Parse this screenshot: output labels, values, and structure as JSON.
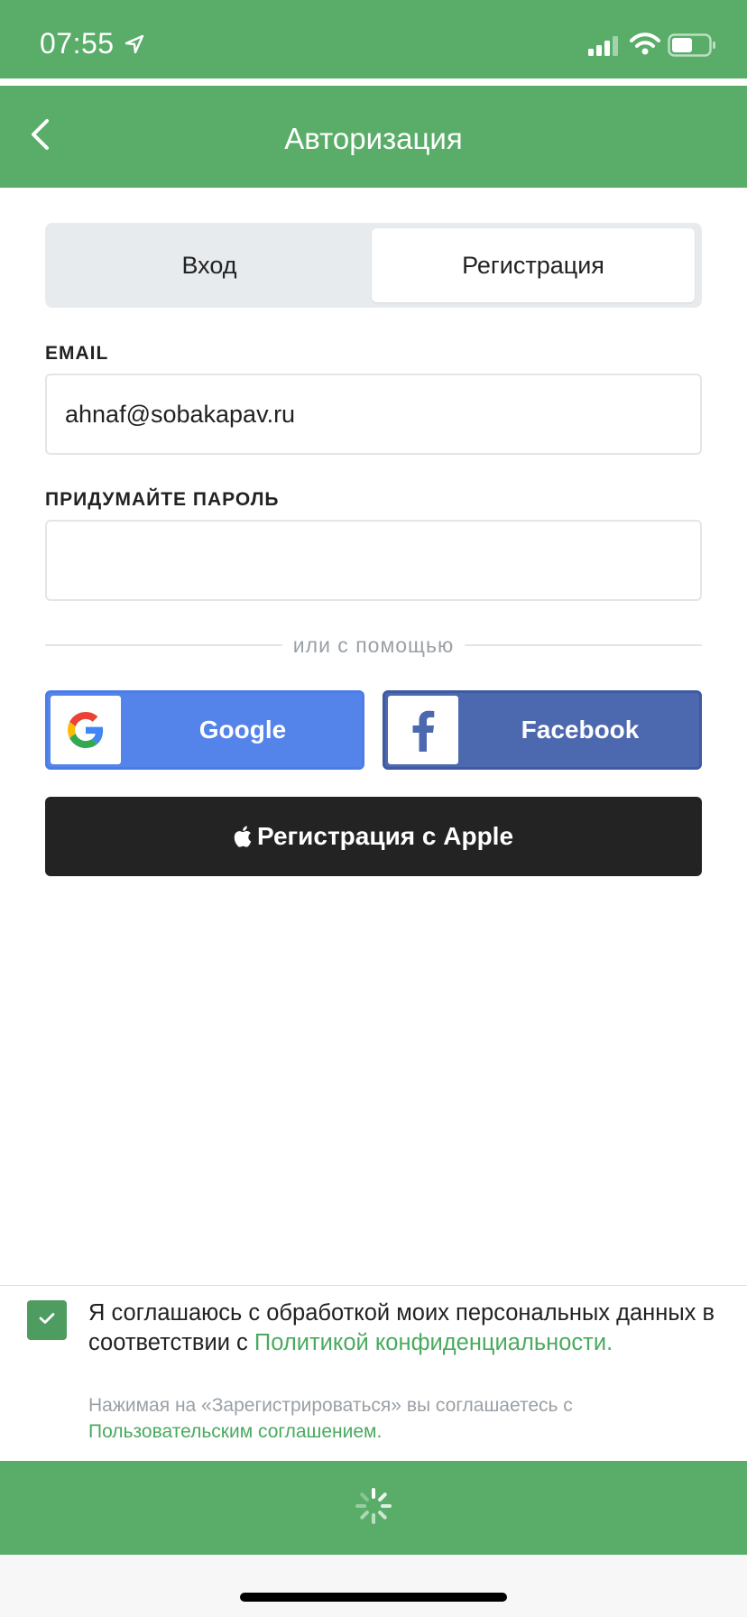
{
  "status_bar": {
    "time": "07:55",
    "icons": [
      "location-arrow-icon",
      "cellular-signal-icon",
      "wifi-icon",
      "battery-icon"
    ]
  },
  "navbar": {
    "back_icon": "chevron-left-icon",
    "title": "Авторизация"
  },
  "tabs": {
    "login": "Вход",
    "register": "Регистрация",
    "selected": "register"
  },
  "form": {
    "email_label": "EMAIL",
    "email_value": "ahnaf@sobakapav.ru",
    "password_label": "ПРИДУМАЙТЕ ПАРОЛЬ",
    "password_value": ""
  },
  "divider_text": "или с помощью",
  "social": {
    "google_label": "Google",
    "google_icon": "google-logo-icon",
    "facebook_label": "Facebook",
    "facebook_icon": "facebook-logo-icon",
    "apple_label": "Регистрация с Apple",
    "apple_icon": "apple-logo-icon"
  },
  "consent": {
    "checked": true,
    "text": "Я соглашаюсь с обработкой моих персональных данных в соответствии с ",
    "policy_link": "Политикой конфиденциальности.",
    "small_text": "Нажимая на «Зарегистрироваться» вы соглашаетесь с ",
    "agreement_link": "Пользовательским соглашением."
  },
  "submit": {
    "state": "loading",
    "icon": "spinner-icon"
  },
  "colors": {
    "brand_green": "#59ad69",
    "link_green": "#4aaa5e",
    "google_blue": "#5483e9",
    "facebook_blue": "#4c68ae",
    "apple_black": "#232323"
  }
}
